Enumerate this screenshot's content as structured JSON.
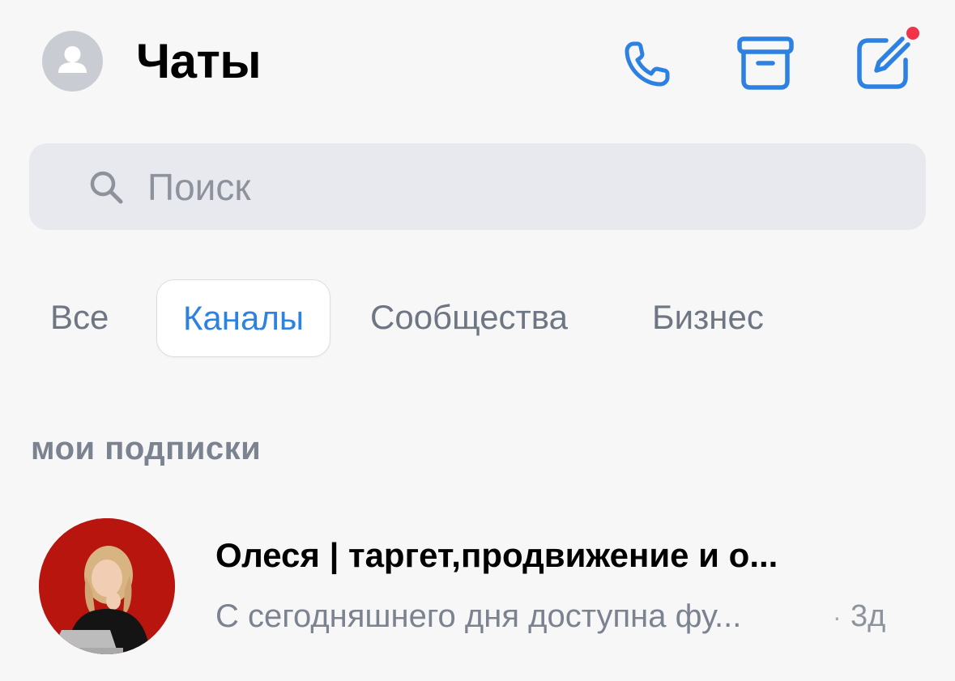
{
  "header": {
    "title": "Чаты",
    "icons": {
      "profile": "user-avatar-icon",
      "call": "phone-icon",
      "archive": "archive-box-icon",
      "compose": "compose-pencil-icon"
    },
    "compose_has_notification": true
  },
  "search": {
    "placeholder": "Поиск",
    "value": ""
  },
  "tabs": [
    {
      "label": "Все",
      "active": false
    },
    {
      "label": "Каналы",
      "active": true
    },
    {
      "label": "Сообщества",
      "active": false
    },
    {
      "label": "Бизнес",
      "active": false
    }
  ],
  "section": {
    "title": "мои подписки"
  },
  "chats": [
    {
      "name": "Олеся | таргет,продвижение и о...",
      "preview": "С сегодняшнего дня доступна фу...",
      "separator": "·",
      "time": "3д"
    }
  ],
  "colors": {
    "accent": "#2d81e0",
    "background": "#f7f7f8",
    "search_bg": "#e8e9ee",
    "muted_text": "#7b8290",
    "notification": "#f2334a",
    "avatar_bg": "#b8150f"
  }
}
